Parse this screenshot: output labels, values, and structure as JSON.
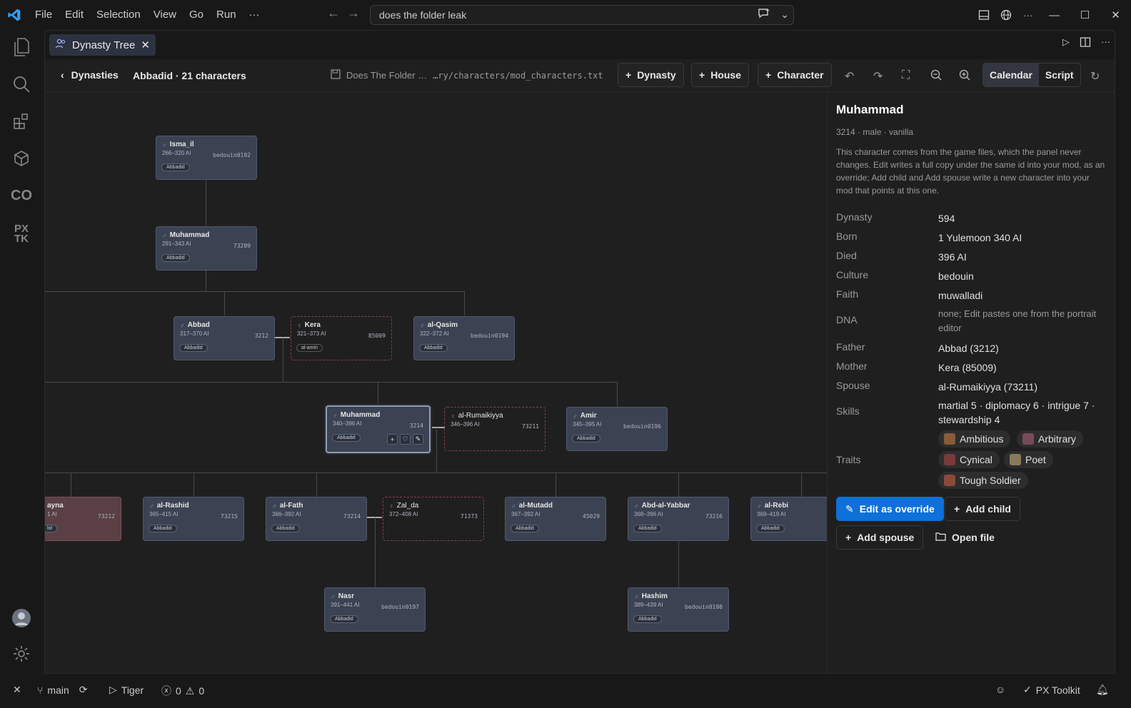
{
  "titlebar": {
    "menu": [
      "File",
      "Edit",
      "Selection",
      "View",
      "Go",
      "Run",
      "···"
    ],
    "search": "does the folder leak"
  },
  "tab": {
    "label": "Dynasty Tree"
  },
  "toolbar": {
    "back_label": "Dynasties",
    "crumb": "Abbadid · 21 characters",
    "file_name": "Does The Folder …",
    "file_path": "…ry/characters/mod_characters.txt",
    "btn_dynasty": "Dynasty",
    "btn_house": "House",
    "btn_character": "Character",
    "seg_calendar": "Calendar",
    "seg_script": "Script"
  },
  "tree": {
    "nodes": [
      {
        "key": "n1",
        "name": "Isma_il",
        "dates": "266–320 AI",
        "id": "bedouin0192",
        "tag": "Abbadid"
      },
      {
        "key": "n2",
        "name": "Muhammad",
        "dates": "291–343 AI",
        "id": "73209",
        "tag": "Abbadid"
      },
      {
        "key": "n3",
        "name": "Abbad",
        "dates": "317–370 AI",
        "id": "3212",
        "tag": "Abbadid"
      },
      {
        "key": "n4",
        "name": "Kera",
        "dates": "321–373 AI",
        "id": "85009",
        "tag": "al-amiri"
      },
      {
        "key": "n5",
        "name": "al-Qasim",
        "dates": "322–372 AI",
        "id": "bedouin0194",
        "tag": "Abbadid"
      },
      {
        "key": "n6",
        "name": "Muhammad",
        "dates": "340–396 AI",
        "id": "3214",
        "tag": "Abbadid"
      },
      {
        "key": "n7",
        "name": "al-Rumaikiyya",
        "dates": "346–396 AI",
        "id": "73211",
        "tag": ""
      },
      {
        "key": "n8",
        "name": "Amir",
        "dates": "345–395 AI",
        "id": "bedouin0196",
        "tag": "Abbadid"
      },
      {
        "key": "n9",
        "name": "ayna",
        "dates": "1 AI",
        "id": "73212",
        "tag": "lid"
      },
      {
        "key": "n10",
        "name": "al-Rashid",
        "dates": "365–415 AI",
        "id": "73215",
        "tag": "Abbadid"
      },
      {
        "key": "n11",
        "name": "al-Fath",
        "dates": "366–392 AI",
        "id": "73214",
        "tag": "Abbadid"
      },
      {
        "key": "n12",
        "name": "Zal_da",
        "dates": "372–408 AI",
        "id": "71373",
        "tag": ""
      },
      {
        "key": "n13",
        "name": "al-Mutadd",
        "dates": "367–392 AI",
        "id": "45029",
        "tag": "Abbadid"
      },
      {
        "key": "n14",
        "name": "Abd-al-Yabbar",
        "dates": "368–396 AI",
        "id": "73216",
        "tag": "Abbadid"
      },
      {
        "key": "n15",
        "name": "al-Rebi",
        "dates": "369–419 AI",
        "id": "",
        "tag": "Abbadid"
      },
      {
        "key": "n16",
        "name": "Nasr",
        "dates": "391–441 AI",
        "id": "bedouin0197",
        "tag": "Abbadid"
      },
      {
        "key": "n17",
        "name": "Hashim",
        "dates": "389–439 AI",
        "id": "bedouin0198",
        "tag": "Abbadid"
      }
    ]
  },
  "panel": {
    "name": "Muhammad",
    "sub": "3214 · male · vanilla",
    "desc": "This character comes from the game files, which the panel never changes. Edit writes a full copy under the same id into your mod, as an override; Add child and Add spouse write a new character into your mod that points at this one.",
    "fields": [
      {
        "k": "Dynasty",
        "v": "594"
      },
      {
        "k": "Born",
        "v": "1 Yulemoon 340 AI"
      },
      {
        "k": "Died",
        "v": "396 AI"
      },
      {
        "k": "Culture",
        "v": "bedouin"
      },
      {
        "k": "Faith",
        "v": "muwalladi"
      },
      {
        "k": "DNA",
        "v": "none; Edit pastes one from the portrait editor"
      },
      {
        "k": "Father",
        "v": "Abbad (3212)"
      },
      {
        "k": "Mother",
        "v": "Kera (85009)"
      },
      {
        "k": "Spouse",
        "v": "al-Rumaikiyya (73211)"
      },
      {
        "k": "Skills",
        "v": "martial 5 · diplomacy 6 · intrigue 7 · stewardship 4"
      },
      {
        "k": "Traits",
        "v": ""
      }
    ],
    "traits": [
      "Ambitious",
      "Arbitrary",
      "Cynical",
      "Poet",
      "Tough Soldier"
    ],
    "btn_edit": "Edit as override",
    "btn_child": "Add child",
    "btn_spouse": "Add spouse",
    "btn_open": "Open file"
  },
  "status": {
    "branch": "main",
    "run": "Tiger",
    "errors": "0",
    "warnings": "0",
    "ext": "PX Toolkit"
  }
}
